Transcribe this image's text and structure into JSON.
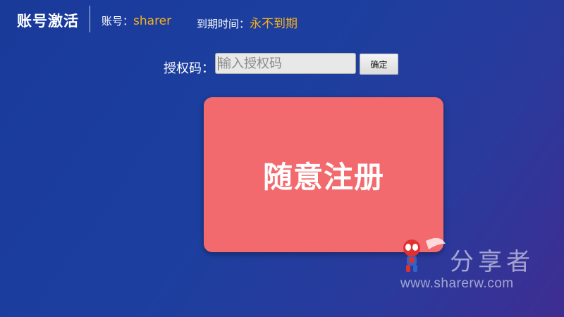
{
  "header": {
    "title": "账号激活",
    "account_label": "账号：",
    "account_value": "sharer",
    "expire_label": "到期时间：",
    "expire_value": "永不到期"
  },
  "auth": {
    "label": "授权码：",
    "placeholder": "输入授权码",
    "value": "",
    "confirm_label": "确定"
  },
  "register": {
    "label": "随意注册"
  },
  "watermark": {
    "brand": "分享者",
    "url": "www.sharerw.com",
    "mascot": "spiderman-mascot-icon"
  },
  "colors": {
    "background": "#1c3f9f",
    "accent_value": "#f5b120",
    "register_card": "#f26a6e"
  }
}
